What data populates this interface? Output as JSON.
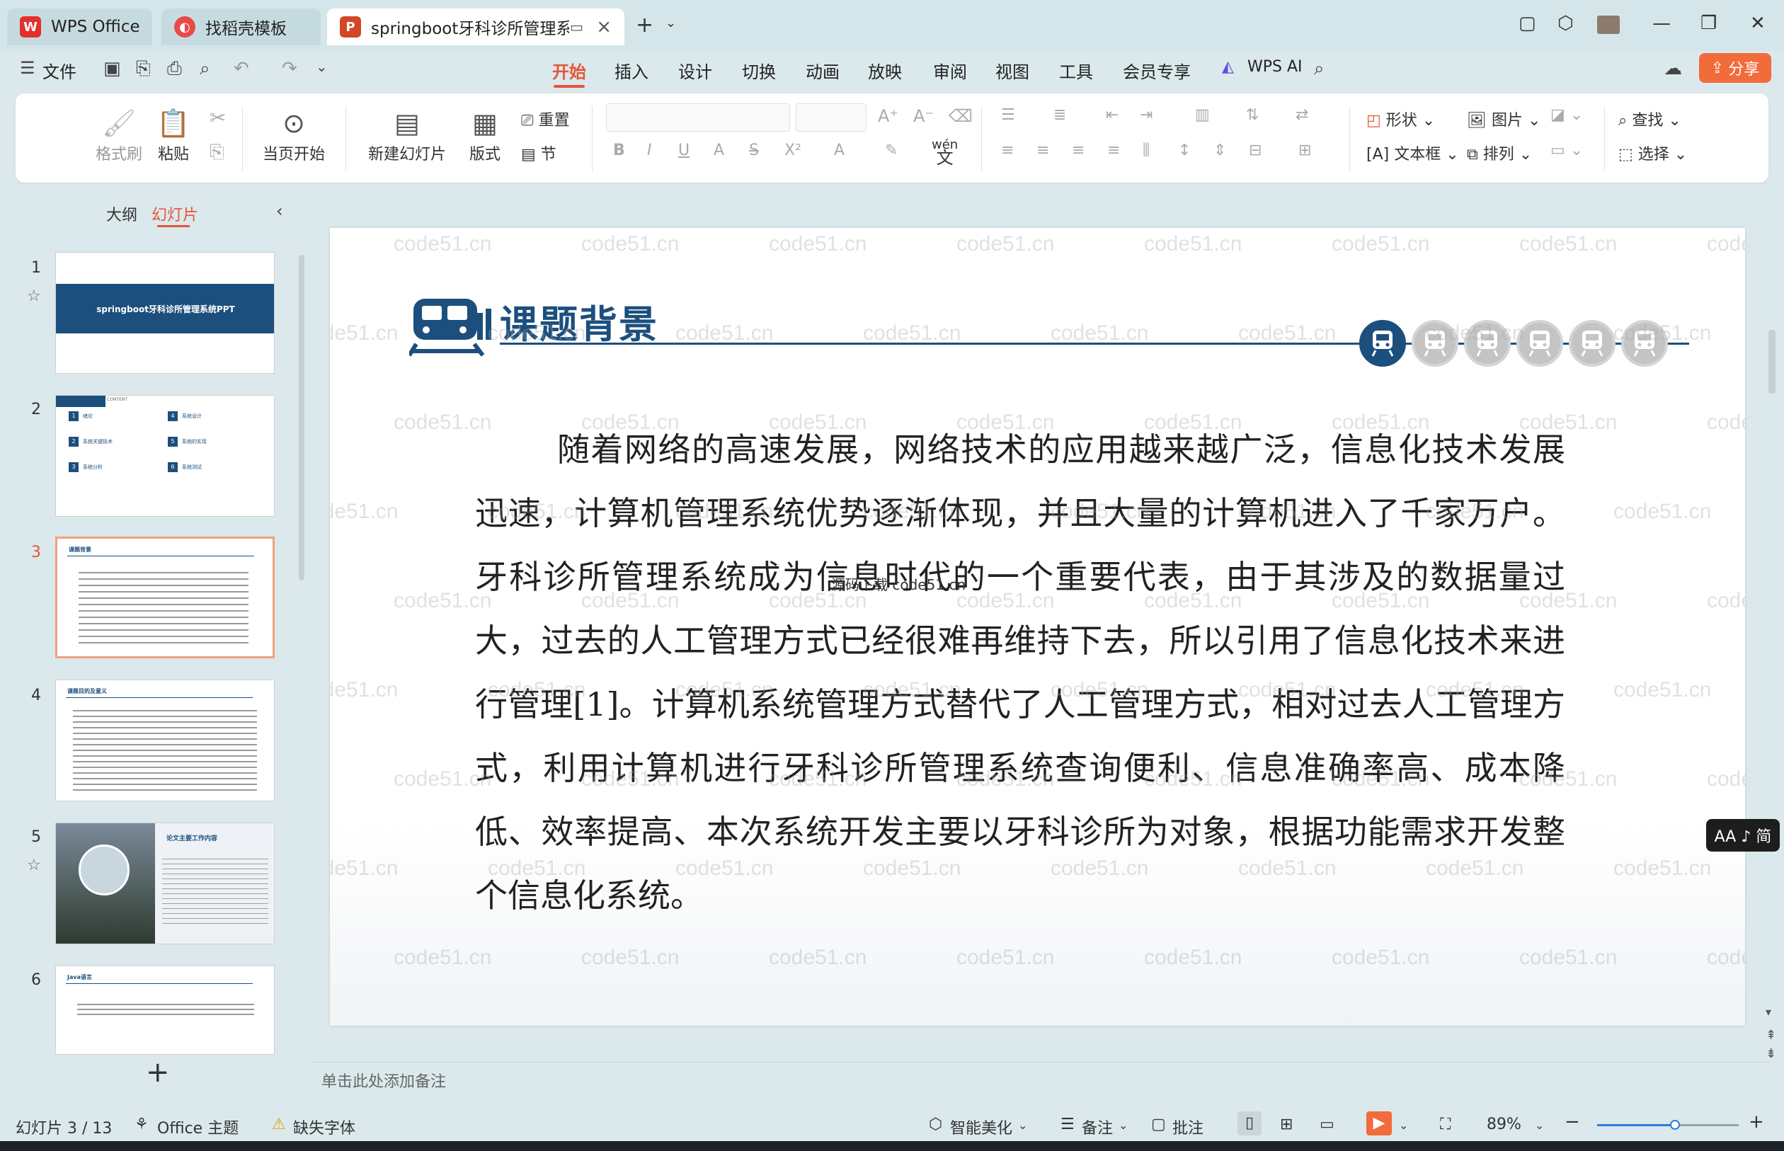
{
  "tabs": [
    {
      "label": "WPS Office",
      "icon": "wps-logo-icon"
    },
    {
      "label": "找稻壳模板",
      "icon": "docer-icon"
    },
    {
      "label": "springboot牙科诊所管理系统",
      "icon": "ppt-icon"
    }
  ],
  "menu": {
    "file": "文件",
    "items": [
      "开始",
      "插入",
      "设计",
      "切换",
      "动画",
      "放映",
      "审阅",
      "视图",
      "工具",
      "会员专享"
    ],
    "active": "开始",
    "wps_ai": "WPS AI",
    "share": "分享"
  },
  "ribbon": {
    "format_painter": "格式刷",
    "paste": "粘贴",
    "play_from_current": "当页开始",
    "new_slide": "新建幻灯片",
    "layout": "版式",
    "reset": "重置",
    "section": "节",
    "shape": "形状",
    "picture": "图片",
    "textbox": "文本框",
    "arrange": "排列",
    "find": "查找",
    "select": "选择",
    "wen": "wén",
    "wen_char": "文"
  },
  "left_panel": {
    "outline_tab": "大纲",
    "slides_tab": "幻灯片",
    "slides": [
      {
        "num": "1",
        "title": "springboot牙科诊所管理系统PPT"
      },
      {
        "num": "2",
        "title": "CONTENT",
        "items": [
          {
            "n": "1",
            "t": "绪论"
          },
          {
            "n": "4",
            "t": "系统设计"
          },
          {
            "n": "2",
            "t": "系统关键技术"
          },
          {
            "n": "5",
            "t": "系统的实现"
          },
          {
            "n": "3",
            "t": "系统分析"
          },
          {
            "n": "6",
            "t": "系统测试"
          }
        ]
      },
      {
        "num": "3",
        "title": "课题背景"
      },
      {
        "num": "4",
        "title": "课题目的及意义"
      },
      {
        "num": "5",
        "title": "论文主要工作内容"
      },
      {
        "num": "6",
        "title": "Java语言"
      }
    ],
    "add_label": "+"
  },
  "slide": {
    "title": "课题背景",
    "body": "随着网络的高速发展，网络技术的应用越来越广泛，信息化技术发展迅速，计算机管理系统优势逐渐体现，并且大量的计算机进入了千家万户。牙科诊所管理系统成为信息时代的一个重要代表，由于其涉及的数据量过大，过去的人工管理方式已经很难再维持下去，所以引用了信息化技术来进行管理[1]。计算机系统管理方式替代了人工管理方式，相对过去人工管理方式，利用计算机进行牙科诊所管理系统查询便利、信息准确率高、成本降低、效率提高、本次系统开发主要以牙科诊所为对象，根据功能需求开发整个信息化系统。",
    "progress_total": 6,
    "progress_active": 1,
    "watermark": "code51.cn",
    "center_watermark": "源码下载 code51.cn"
  },
  "notes_placeholder": "单击此处添加备注",
  "status": {
    "slide_counter": "幻灯片 3 / 13",
    "theme": "Office 主题",
    "missing_font": "缺失字体",
    "smart_beautify": "智能美化",
    "notes": "备注",
    "comments": "批注",
    "zoom": "89%",
    "zoom_fraction": 0.55
  },
  "aa_button": "AA ♪ 简",
  "colors": {
    "accent": "#e6553a",
    "slide_blue": "#1c4f7d",
    "share": "#f26b3a"
  }
}
